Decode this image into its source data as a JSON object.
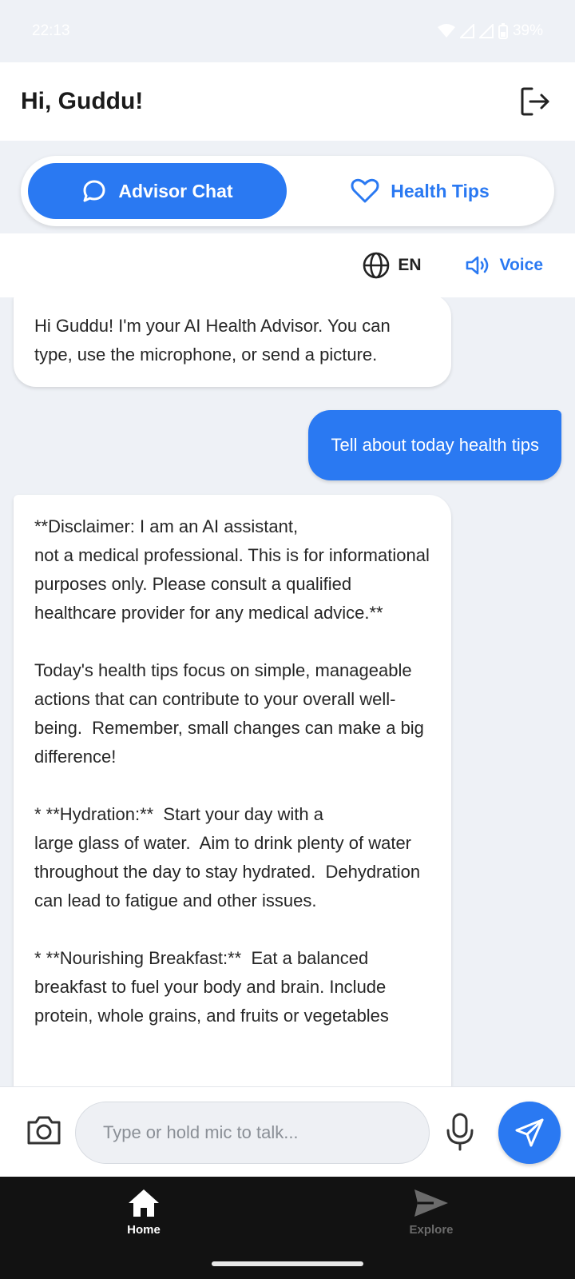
{
  "status": {
    "time": "22:13",
    "battery": "39%"
  },
  "header": {
    "greeting": "Hi, Guddu!"
  },
  "tabs": [
    {
      "label": "Advisor Chat",
      "icon": "chat-bubble-icon",
      "active": true
    },
    {
      "label": "Health Tips",
      "icon": "heart-icon",
      "active": false
    }
  ],
  "language_bar": {
    "language": "EN",
    "voice_label": "Voice"
  },
  "messages": [
    {
      "role": "bot",
      "text": "Hi Guddu! I'm your AI Health Advisor. You can type, use the microphone, or send a picture."
    },
    {
      "role": "user",
      "text": "Tell about today health tips"
    },
    {
      "role": "bot",
      "text": "**Disclaimer: I am an AI assistant,\nnot a medical professional. This is for informational purposes only. Please consult a qualified healthcare provider for any medical advice.**\n\nToday's health tips focus on simple, manageable actions that can contribute to your overall well-being.  Remember, small changes can make a big difference!\n\n* **Hydration:**  Start your day with a\nlarge glass of water.  Aim to drink plenty of water throughout the day to stay hydrated.  Dehydration can lead to fatigue and other issues.\n\n* **Nourishing Breakfast:**  Eat a balanced breakfast to fuel your body and brain. Include protein, whole grains, and fruits or vegetables"
    }
  ],
  "composer": {
    "placeholder": "Type or hold mic to talk..."
  },
  "nav": [
    {
      "label": "Home",
      "icon": "home-icon",
      "active": true
    },
    {
      "label": "Explore",
      "icon": "send-icon",
      "active": false
    }
  ],
  "colors": {
    "accent": "#2a79f2",
    "background": "#eef1f6",
    "nav_bg": "#121212"
  }
}
